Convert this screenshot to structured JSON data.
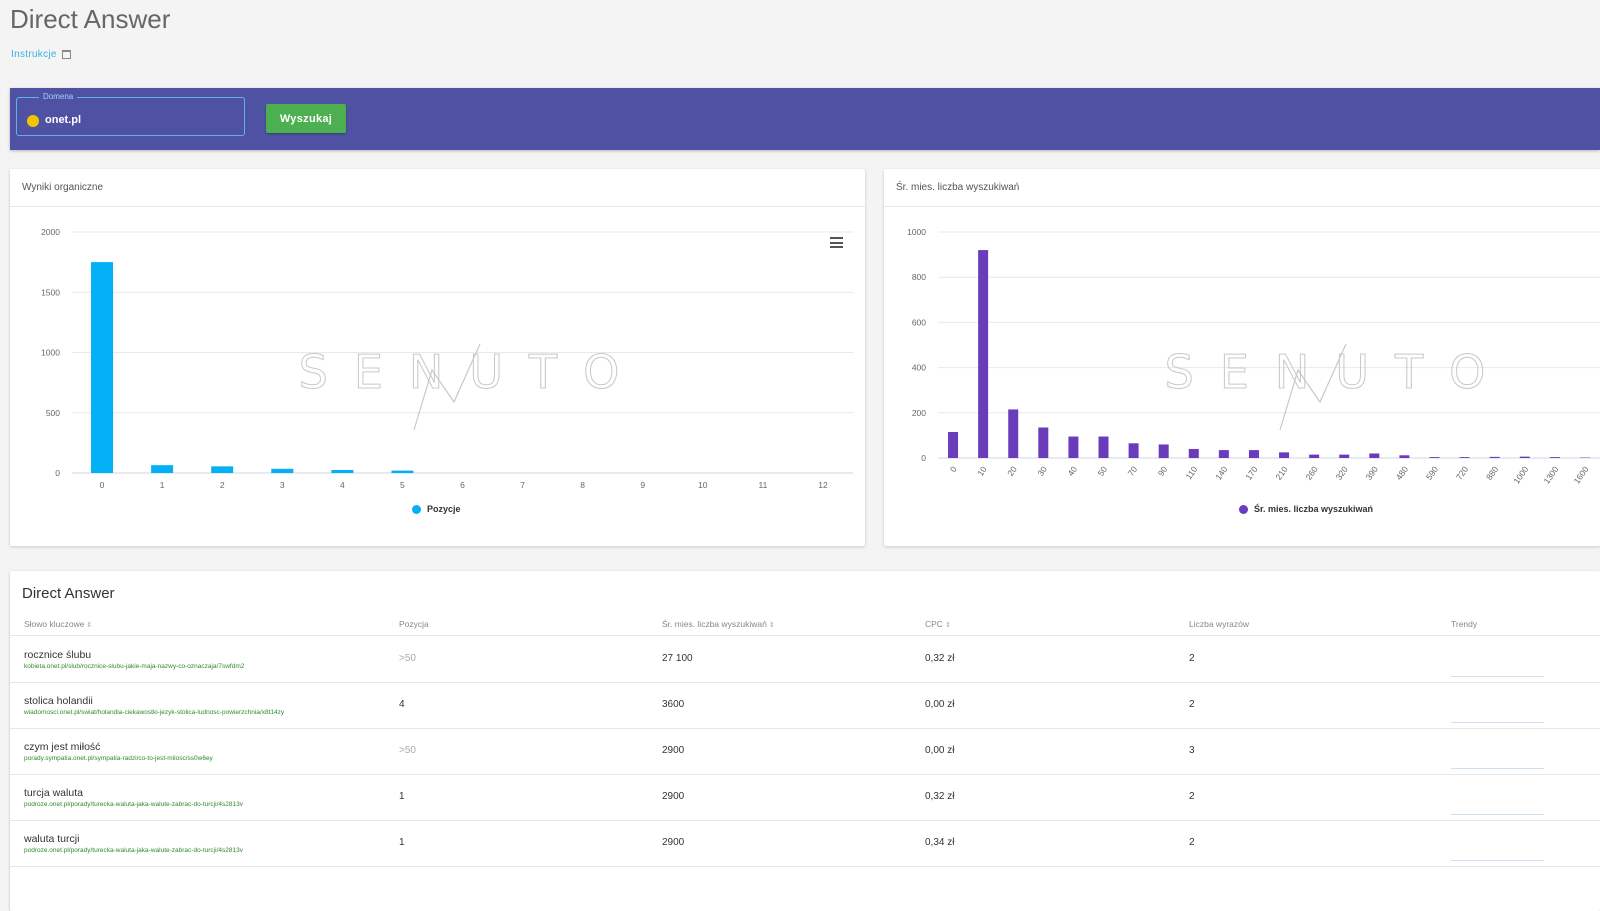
{
  "header": {
    "title": "Direct Answer",
    "instructions_link": "Instrukcje"
  },
  "search": {
    "domain_label": "Domena",
    "domain_value": "onet.pl",
    "button_label": "Wyszukaj"
  },
  "organic_card": {
    "title": "Wyniki organiczne",
    "chart_data": {
      "type": "bar",
      "title": "",
      "categories": [
        "0",
        "1",
        "2",
        "3",
        "4",
        "5",
        "6",
        "7",
        "8",
        "9",
        "10",
        "11",
        "12"
      ],
      "series": [
        {
          "name": "Pozycje",
          "values": [
            1750,
            65,
            55,
            35,
            25,
            20,
            0,
            0,
            0,
            0,
            0,
            0,
            0
          ]
        }
      ],
      "y_ticks": [
        "0",
        "500",
        "1000",
        "1500",
        "2000"
      ],
      "ylim": [
        0,
        2000
      ],
      "grid": true,
      "legend": "bottom-center",
      "color": "#03b0f5"
    }
  },
  "volume_card": {
    "title": "Śr. mies. liczba wyszukiwań",
    "chart_data": {
      "type": "bar",
      "title": "",
      "categories": [
        "0",
        "10",
        "20",
        "30",
        "40",
        "50",
        "70",
        "90",
        "110",
        "140",
        "170",
        "210",
        "260",
        "320",
        "390",
        "480",
        "590",
        "720",
        "880",
        "1000",
        "1300",
        "1600"
      ],
      "series": [
        {
          "name": "Śr. mies. liczba wyszukiwań",
          "values": [
            115,
            920,
            215,
            135,
            95,
            95,
            65,
            60,
            40,
            35,
            35,
            25,
            15,
            15,
            20,
            12,
            4,
            4,
            5,
            6,
            4,
            2
          ]
        }
      ],
      "y_ticks": [
        "0",
        "200",
        "400",
        "600",
        "800",
        "1000"
      ],
      "ylim": [
        0,
        1000
      ],
      "grid": true,
      "legend": "bottom-center",
      "color": "#6a3cbc"
    }
  },
  "watermark": "SENUTO",
  "table": {
    "title": "Direct Answer",
    "columns": [
      "Słowo kluczowe",
      "Pozycja",
      "Śr. mies. liczba wyszukiwań",
      "CPC",
      "Liczba wyrazów",
      "Trendy"
    ],
    "rows": [
      {
        "keyword": "rocznice ślubu",
        "url": "kobieta.onet.pl/slub/rocznice-slubu-jakie-maja-nazwy-co-oznaczaja/7swfdm2",
        "position": ">50",
        "volume": "27 100",
        "cpc": "0,32 zł",
        "words": "2"
      },
      {
        "keyword": "stolica holandii",
        "url": "wiadomosci.onet.pl/swiat/holandia-ciekawostki-jezyk-stolica-ludnosc-powierzchnia/x8t14zy",
        "position": "4",
        "volume": "3600",
        "cpc": "0,00 zł",
        "words": "2"
      },
      {
        "keyword": "czym jest miłość",
        "url": "porady.sympatia.onet.pl/sympatia-radzi/co-to-jest-milosc/ss0w6ey",
        "position": ">50",
        "volume": "2900",
        "cpc": "0,00 zł",
        "words": "3"
      },
      {
        "keyword": "turcja waluta",
        "url": "podroze.onet.pl/porady/turecka-waluta-jaka-walute-zabrac-do-turcji/4s2813v",
        "position": "1",
        "volume": "2900",
        "cpc": "0,32 zł",
        "words": "2"
      },
      {
        "keyword": "waluta turcji",
        "url": "podroze.onet.pl/porady/turecka-waluta-jaka-walute-zabrac-do-turcji/4s2813v",
        "position": "1",
        "volume": "2900",
        "cpc": "0,34 zł",
        "words": "2"
      }
    ]
  }
}
